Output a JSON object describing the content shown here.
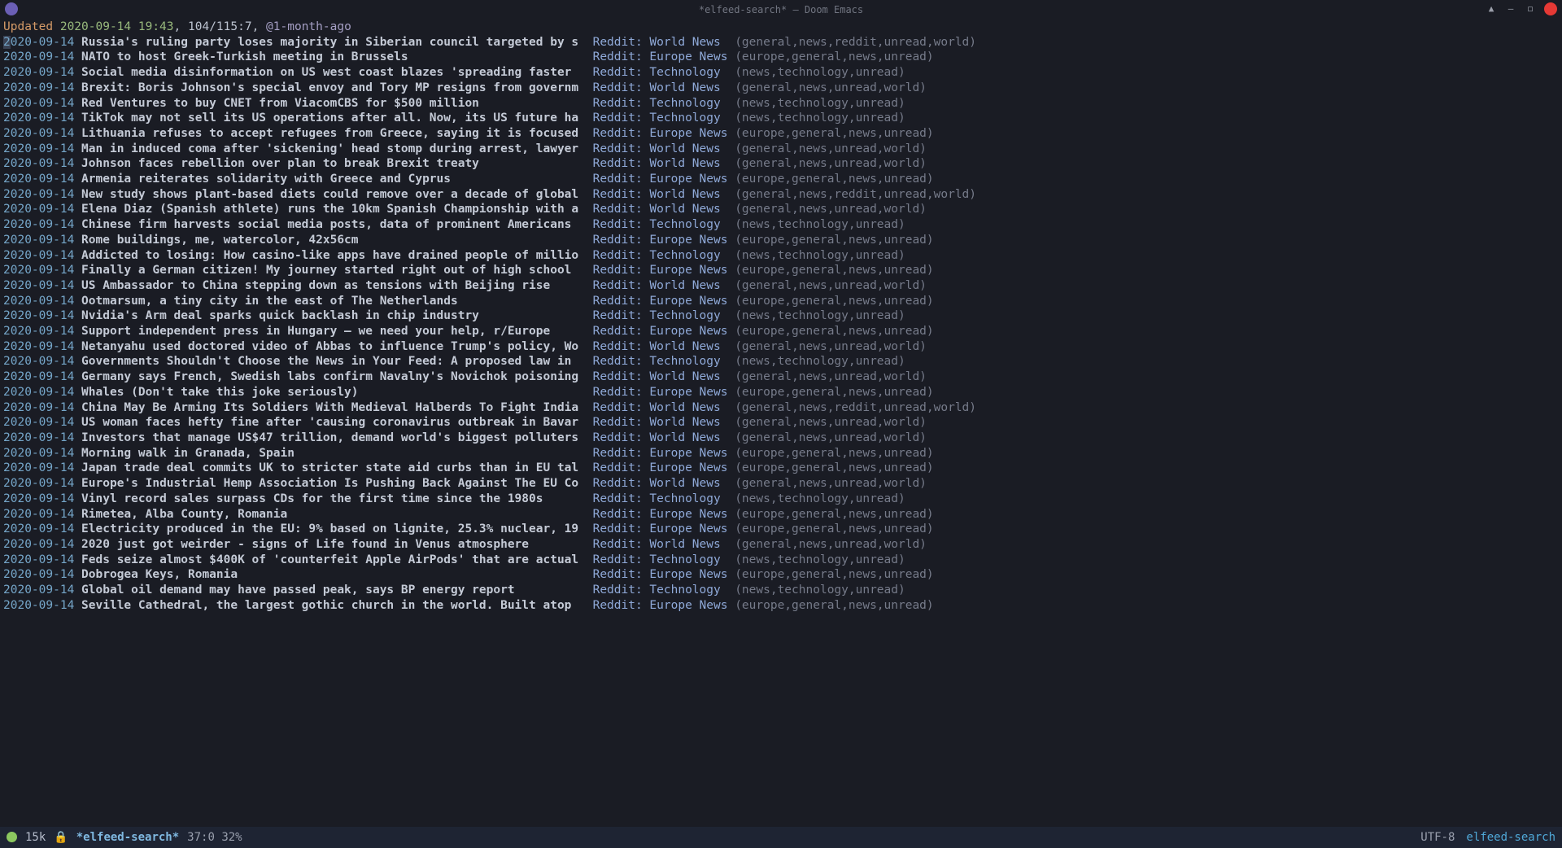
{
  "titlebar": {
    "title": "*elfeed-search* – Doom Emacs"
  },
  "header": {
    "updated_label": "Updated",
    "updated_time": "2020-09-14 19:43",
    "counts": "104/115:7",
    "query": "@1-month-ago"
  },
  "feeds": {
    "world": "Reddit: World News",
    "europe": "Reddit: Europe News",
    "tech": "Reddit: Technology"
  },
  "tagstr": {
    "world": "(general,news,reddit,unread,world)",
    "world2": "(general,news,unread,world)",
    "europe": "(europe,general,news,unread)",
    "tech": "(news,technology,unread)"
  },
  "entries": [
    {
      "date": "2020-09-14",
      "title": "Russia's ruling party loses majority in Siberian council targeted by s",
      "feed": "world",
      "tags": "world",
      "selected": true
    },
    {
      "date": "2020-09-14",
      "title": "NATO to host Greek-Turkish meeting in Brussels",
      "feed": "europe",
      "tags": "europe"
    },
    {
      "date": "2020-09-14",
      "title": "Social media disinformation on US west coast blazes 'spreading faster ",
      "feed": "tech",
      "tags": "tech"
    },
    {
      "date": "2020-09-14",
      "title": "Brexit: Boris Johnson's special envoy and Tory MP resigns from governm",
      "feed": "world",
      "tags": "world2"
    },
    {
      "date": "2020-09-14",
      "title": "Red Ventures to buy CNET from ViacomCBS for $500 million",
      "feed": "tech",
      "tags": "tech"
    },
    {
      "date": "2020-09-14",
      "title": "TikTok may not sell its US operations after all. Now, its US future ha",
      "feed": "tech",
      "tags": "tech"
    },
    {
      "date": "2020-09-14",
      "title": "Lithuania refuses to accept refugees from Greece, saying it is focused",
      "feed": "europe",
      "tags": "europe"
    },
    {
      "date": "2020-09-14",
      "title": "Man in induced coma after 'sickening' head stomp during arrest, lawyer",
      "feed": "world",
      "tags": "world2"
    },
    {
      "date": "2020-09-14",
      "title": "Johnson faces rebellion over plan to break Brexit treaty",
      "feed": "world",
      "tags": "world2"
    },
    {
      "date": "2020-09-14",
      "title": "Armenia reiterates solidarity with Greece and Cyprus",
      "feed": "europe",
      "tags": "europe"
    },
    {
      "date": "2020-09-14",
      "title": "New study shows plant-based diets could remove over a decade of global",
      "feed": "world",
      "tags": "world"
    },
    {
      "date": "2020-09-14",
      "title": "Elena Diaz (Spanish athlete) runs the 10km Spanish Championship with a",
      "feed": "world",
      "tags": "world2"
    },
    {
      "date": "2020-09-14",
      "title": "Chinese firm harvests social media posts, data of prominent Americans ",
      "feed": "tech",
      "tags": "tech"
    },
    {
      "date": "2020-09-14",
      "title": "Rome buildings, me, watercolor, 42x56cm",
      "feed": "europe",
      "tags": "europe"
    },
    {
      "date": "2020-09-14",
      "title": "Addicted to losing: How casino-like apps have drained people of millio",
      "feed": "tech",
      "tags": "tech"
    },
    {
      "date": "2020-09-14",
      "title": "Finally a German citizen! My journey started right out of high school ",
      "feed": "europe",
      "tags": "europe"
    },
    {
      "date": "2020-09-14",
      "title": "US Ambassador to China stepping down as tensions with Beijing rise",
      "feed": "world",
      "tags": "world2"
    },
    {
      "date": "2020-09-14",
      "title": "Ootmarsum, a tiny city in the east of The Netherlands",
      "feed": "europe",
      "tags": "europe"
    },
    {
      "date": "2020-09-14",
      "title": "Nvidia's Arm deal sparks quick backlash in chip industry",
      "feed": "tech",
      "tags": "tech"
    },
    {
      "date": "2020-09-14",
      "title": "Support independent press in Hungary – we need your help, r/Europe",
      "feed": "europe",
      "tags": "europe"
    },
    {
      "date": "2020-09-14",
      "title": "Netanyahu used doctored video of Abbas to influence Trump's policy, Wo",
      "feed": "world",
      "tags": "world2"
    },
    {
      "date": "2020-09-14",
      "title": "Governments Shouldn't Choose the News in Your Feed: A proposed law in ",
      "feed": "tech",
      "tags": "tech"
    },
    {
      "date": "2020-09-14",
      "title": "Germany says French, Swedish labs confirm Navalny's Novichok poisoning",
      "feed": "world",
      "tags": "world2"
    },
    {
      "date": "2020-09-14",
      "title": "Whales (Don't take this joke seriously)",
      "feed": "europe",
      "tags": "europe"
    },
    {
      "date": "2020-09-14",
      "title": "China May Be Arming Its Soldiers With Medieval Halberds To Fight India",
      "feed": "world",
      "tags": "world"
    },
    {
      "date": "2020-09-14",
      "title": "US woman faces hefty fine after 'causing coronavirus outbreak in Bavar",
      "feed": "world",
      "tags": "world2"
    },
    {
      "date": "2020-09-14",
      "title": "Investors that manage US$47 trillion, demand world's biggest polluters",
      "feed": "world",
      "tags": "world2"
    },
    {
      "date": "2020-09-14",
      "title": "Morning walk in Granada, Spain",
      "feed": "europe",
      "tags": "europe"
    },
    {
      "date": "2020-09-14",
      "title": "Japan trade deal commits UK to stricter state aid curbs than in EU tal",
      "feed": "europe",
      "tags": "europe"
    },
    {
      "date": "2020-09-14",
      "title": "Europe's Industrial Hemp Association Is Pushing Back Against The EU Co",
      "feed": "world",
      "tags": "world2"
    },
    {
      "date": "2020-09-14",
      "title": "Vinyl record sales surpass CDs for the first time since the 1980s",
      "feed": "tech",
      "tags": "tech"
    },
    {
      "date": "2020-09-14",
      "title": "Rimetea, Alba County, Romania",
      "feed": "europe",
      "tags": "europe"
    },
    {
      "date": "2020-09-14",
      "title": "Electricity produced in the EU: 9% based on lignite, 25.3% nuclear, 19",
      "feed": "europe",
      "tags": "europe"
    },
    {
      "date": "2020-09-14",
      "title": "2020 just got weirder - signs of Life found in Venus atmosphere",
      "feed": "world",
      "tags": "world2"
    },
    {
      "date": "2020-09-14",
      "title": "Feds seize almost $400K of 'counterfeit Apple AirPods' that are actual",
      "feed": "tech",
      "tags": "tech"
    },
    {
      "date": "2020-09-14",
      "title": "Dobrogea Keys, Romania",
      "feed": "europe",
      "tags": "europe"
    },
    {
      "date": "2020-09-14",
      "title": "Global oil demand may have passed peak, says BP energy report",
      "feed": "tech",
      "tags": "tech"
    },
    {
      "date": "2020-09-14",
      "title": "Seville Cathedral, the largest gothic church in the world. Built atop ",
      "feed": "europe",
      "tags": "europe"
    }
  ],
  "modeline": {
    "size": "15k",
    "lock_icon": "🔒",
    "buffer": "*elfeed-search*",
    "position": "37:0 32%",
    "encoding": "UTF-8",
    "mode": "elfeed-search"
  }
}
